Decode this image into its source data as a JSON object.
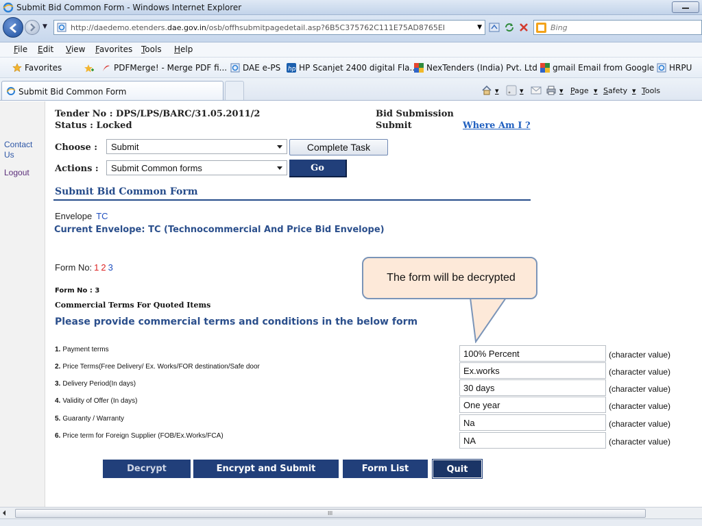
{
  "window": {
    "title": "Submit Bid Common Form - Windows Internet Explorer"
  },
  "address_bar": {
    "url_prefix": "http://daedemo.etenders.",
    "url_domain": "dae.gov.in",
    "url_path": "/osb/offhsubmitpagedetail.asp?6B5C375762C111E75AD8765EI",
    "search_placeholder": "Bing"
  },
  "menu": {
    "items": [
      "File",
      "Edit",
      "View",
      "Favorites",
      "Tools",
      "Help"
    ]
  },
  "favorites_bar": {
    "label": "Favorites",
    "items": [
      "PDFMerge! - Merge PDF fi...",
      "DAE e-PS",
      "HP Scanjet 2400 digital Fla...",
      "NexTenders (India) Pvt. Ltd",
      "gmail Email from Google",
      "HRPU"
    ]
  },
  "tabs": {
    "active": "Submit Bid Common Form",
    "commands": [
      "Page",
      "Safety",
      "Tools"
    ]
  },
  "sidebar": {
    "contact": "Contact Us",
    "logout": "Logout"
  },
  "header": {
    "tender_no": "Tender No : DPS/LPS/BARC/31.05.2011/2",
    "status": "Status : Locked",
    "bid_submission": "Bid Submission",
    "submit": "Submit",
    "where_am_i": "Where Am I ?"
  },
  "controls": {
    "choose_label": "Choose :",
    "choose_value": "Submit",
    "complete_task": "Complete Task",
    "actions_label": "Actions :",
    "actions_value": "Submit Common forms",
    "go": "Go"
  },
  "form": {
    "section_title": "Submit Bid Common Form",
    "envelope_label": "Envelope",
    "envelope_value": "TC",
    "current_envelope": "Current Envelope: TC (Technocommercial And Price Bid Envelope)",
    "form_no_label": "Form No:",
    "form_numbers": [
      "1",
      "2",
      "3"
    ],
    "form_no_current": "Form No : 3",
    "form_name": "Commercial Terms For Quoted Items",
    "instructions": "Please provide commercial terms and conditions in the below form",
    "rows": [
      {
        "num": "1.",
        "label": "Payment terms",
        "value": "100% Percent",
        "hint": "(character value)"
      },
      {
        "num": "2.",
        "label": "Price Terms(Free Delivery/ Ex. Works/FOR destination/Safe door",
        "value": "Ex.works",
        "hint": "(character value)"
      },
      {
        "num": "3.",
        "label": "Delivery Period(In days)",
        "value": "30 days",
        "hint": "(character value)"
      },
      {
        "num": "4.",
        "label": "Validity of Offer (In days)",
        "value": "One year",
        "hint": "(character value)"
      },
      {
        "num": "5.",
        "label": "Guaranty / Warranty",
        "value": "Na",
        "hint": "(character value)"
      },
      {
        "num": "6.",
        "label": "Price term for Foreign Supplier (FOB/Ex.Works/FCA)",
        "value": "NA",
        "hint": "(character value)"
      }
    ]
  },
  "buttons": {
    "decrypt": "Decrypt",
    "encrypt_submit": "Encrypt and Submit",
    "form_list": "Form List",
    "quit": "Quit"
  },
  "callout": {
    "text": "The form will be decrypted"
  },
  "scrollbar": {
    "grip": "III"
  },
  "colors": {
    "navy_button": "#213f7a",
    "heading_blue": "#2b4f8c",
    "callout_fill": "#fde9d9",
    "callout_border": "#7a94b8"
  }
}
